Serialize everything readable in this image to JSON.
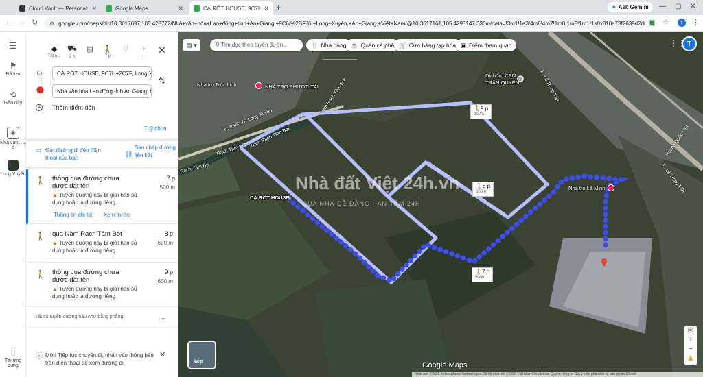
{
  "browser": {
    "tabs": [
      {
        "title": "Cloud Vault — Personal Data C",
        "active": false
      },
      {
        "title": "Google Maps",
        "active": false
      },
      {
        "title": "CÀ RỐT HOUSE, 9C7H+2C7P, L",
        "active": true
      }
    ],
    "ask_gemini": "Ask Gemini",
    "url": "google.com/maps/dir/10.3617697,105.428772/Nhà+văn+hóa+Lao+động+tỉnh+An+Giang,+9C6/%2BFJ6,+Long+Xuyên,+An+Giang,+Việt+Nam/@10.3617161,105.4293147,330m/data=!3m1!1e3!4m8!4m7!1m0!1m5!1m1!1s0x310a73f2639d2d61:0x314569e7b...",
    "profile_initial": "T"
  },
  "rail": {
    "items": [
      {
        "label": "Đã lưu",
        "icon": "bookmark-icon"
      },
      {
        "label": "Gần đây",
        "icon": "history-icon"
      },
      {
        "label": "Nhà vàn... 2 p",
        "icon": "directions-icon"
      },
      {
        "label": "Long Xuyên",
        "icon": "place-thumb-icon"
      },
      {
        "label": "Tải ứng dụng",
        "icon": "phone-icon"
      }
    ]
  },
  "directions": {
    "modes": [
      {
        "label": "Tốt n...",
        "icon": "best-route-icon",
        "active": true
      },
      {
        "label": "2 p",
        "icon": "car-icon",
        "active": false
      },
      {
        "label": "",
        "icon": "transit-icon",
        "active": false
      },
      {
        "label": "7 p",
        "icon": "walk-icon",
        "active": false
      },
      {
        "label": "",
        "icon": "bike-icon",
        "active": false
      },
      {
        "label": "—",
        "icon": "flight-icon",
        "active": false
      }
    ],
    "origin": "CÀ RỐT HOUSE, 9C7H+2C7P, Long Xuyê",
    "destination": "Nhà văn hóa Lao động tỉnh An Giang, 9C",
    "add_destination": "Thêm điểm đến",
    "options": "Tuỳ chọn",
    "send_to_phone": "Gửi đường đi đến điện thoại của bạn",
    "copy_link": "Sao chép đường liên kết",
    "steps": [
      {
        "title": "thông qua đường chưa được đặt tên",
        "time": "7 p",
        "distance": "500 m",
        "warning": "Tuyến đường này bị giới hạn sử dụng hoặc là đường riêng.",
        "details": "Thông tin chi tiết",
        "preview": "Xem trước"
      },
      {
        "title": "qua Nam Rạch Tầm Bót",
        "time": "8 p",
        "distance": "600 m",
        "warning": "Tuyến đường này bị giới hạn sử dụng hoặc là đường riêng."
      },
      {
        "title": "thông qua đường chưa được đặt tên",
        "time": "9 p",
        "distance": "600 m",
        "warning": "Tuyến đường này bị giới hạn sử dụng hoặc là đường riêng."
      }
    ],
    "flat_note": "Tất cả tuyến đường hầu như bằng phẳng",
    "notice": "Mới! Tiếp tục chuyến đi, nhấn vào thông báo trên điện thoại để xem đường đi"
  },
  "map": {
    "search_placeholder": "Tìm dọc theo tuyến đườn...",
    "chips": [
      {
        "label": "Nhà hàng",
        "icon": "restaurant-icon"
      },
      {
        "label": "Quán cà phê",
        "icon": "cafe-icon"
      },
      {
        "label": "Cửa hàng tạp hóa",
        "icon": "grocery-icon"
      },
      {
        "label": "Điểm tham quan",
        "icon": "camera-icon"
      }
    ],
    "labels": {
      "nha_tro_truc_linh": "Nhà trọ Trúc Linh",
      "nha_tro_phuoc_tai": "NHÀ TRỌ PHƯỚC TÀI",
      "dich_vu_cpn": "Dịch Vụ CPN",
      "tran_quyen": "TRẦN QUYÊN",
      "ca_rot_house": "CÀ RỐT HOUSE",
      "nha_tro_le_minh": "Nhà trọ Lê Minh",
      "rach_tam_bot": "Rạch Tầm Bót",
      "rach_tam_bot_2": "Rạch Tầm Bót",
      "tranh_tp": "Đ. tránh TP Long Xuyên",
      "nam_rach_1": "Nam Rạch Tầm Bót",
      "nam_rach_2": "Nam Rạch Tầm Bót",
      "le_trong_tan_1": "Đ. Lê Trọng Tấn",
      "le_trong_tan_2": "Đ. Lê Trọng Tấn",
      "hoang_quoc_viet": "Hoàng Quốc Việt"
    },
    "time_tags": [
      {
        "time": "9 p",
        "dist": "600m"
      },
      {
        "time": "8 p",
        "dist": "600m"
      },
      {
        "time": "7 p",
        "dist": "500m"
      }
    ],
    "watermark": "Nhà đất Việt 24h.vn",
    "watermark_sub": "QUA NHÀ DỄ DÀNG - AN TÂM 24H",
    "layers_label": "Lớp",
    "logo": "Google Maps",
    "attribution": "Hình ảnh ©2026 Airbus,Maxar Technologies,Dữ liệu bản đồ ©2026   Việt Nam   Điều khoản   Quyền riêng tư   Gửi ý kiến phản hồi về sản phẩm   20 mét",
    "colors": {
      "route_active": "#3c4ef0",
      "route_alt": "#b7bfff",
      "dest_pin": "#ea4335"
    }
  }
}
